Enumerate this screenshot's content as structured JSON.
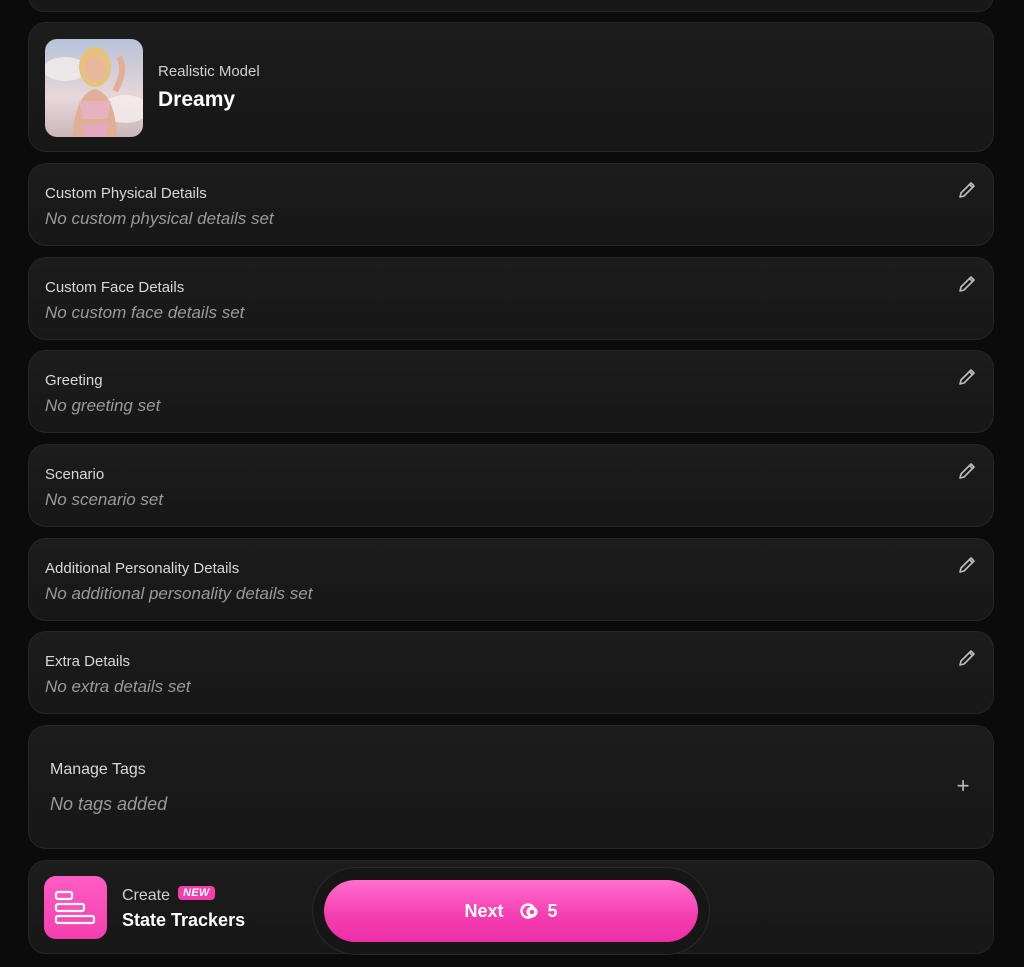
{
  "model": {
    "subtitle": "Realistic Model",
    "name": "Dreamy"
  },
  "details": [
    {
      "label": "Custom Physical Details",
      "value": "No custom physical details set"
    },
    {
      "label": "Custom Face Details",
      "value": "No custom face details set"
    },
    {
      "label": "Greeting",
      "value": "No greeting set"
    },
    {
      "label": "Scenario",
      "value": "No scenario set"
    },
    {
      "label": "Additional Personality Details",
      "value": "No additional personality details set"
    },
    {
      "label": "Extra Details",
      "value": "No extra details set"
    }
  ],
  "tags": {
    "label": "Manage Tags",
    "value": "No tags added",
    "add_icon": "plus-icon"
  },
  "tracker": {
    "create_label": "Create",
    "badge": "NEW",
    "title": "State Trackers",
    "icon": "tracker-bars-icon"
  },
  "next_button": {
    "label": "Next",
    "cost": "5",
    "icon": "coin-icon"
  },
  "colors": {
    "accent": "#f53dae",
    "background": "#0b0b0b",
    "card": "#1a1a1a"
  }
}
